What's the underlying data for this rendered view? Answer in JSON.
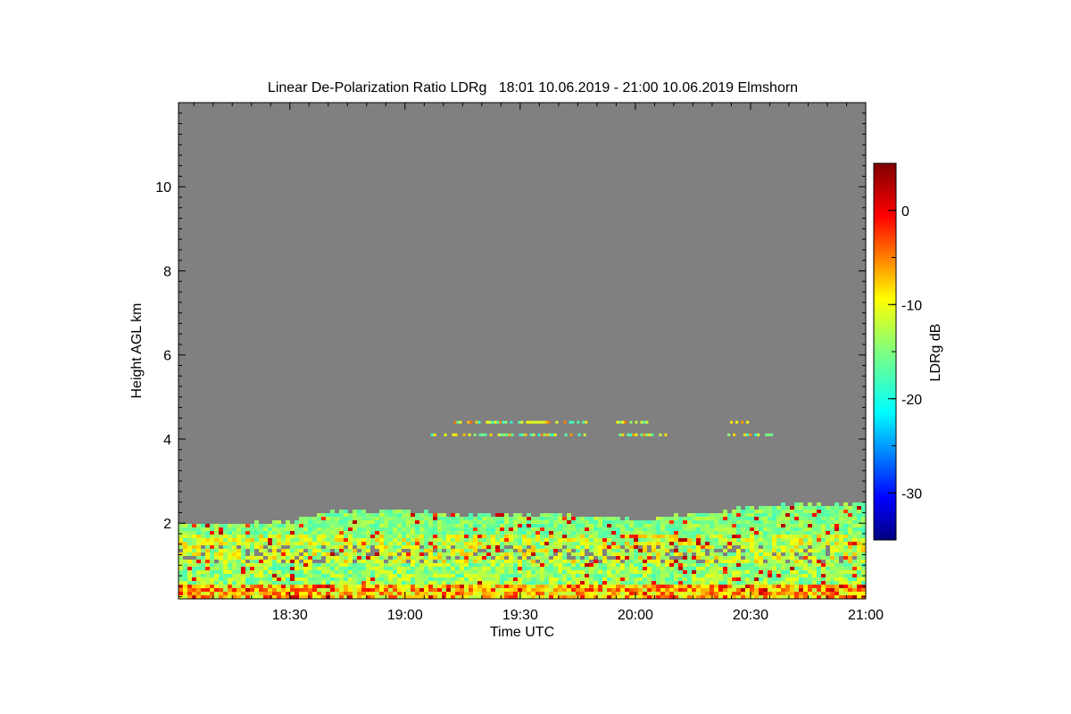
{
  "chart_data": {
    "type": "heatmap",
    "title": "Linear De-Polarization Ratio LDRg   18:01 10.06.2019 - 21:00 10.06.2019 Elmshorn",
    "xlabel": "Time UTC",
    "ylabel": "Height AGL km",
    "colorbar_label": "LDRg dB",
    "x_range": [
      "18:01",
      "21:00"
    ],
    "x_ticks": [
      "18:30",
      "19:00",
      "19:30",
      "20:00",
      "20:30",
      "21:00"
    ],
    "y_range_km": [
      0.2,
      12.0
    ],
    "y_ticks": [
      "2",
      "4",
      "6",
      "8",
      "10"
    ],
    "colorbar_range_db": [
      -35,
      5
    ],
    "colorbar_ticks": [
      "0",
      "-10",
      "-20",
      "-30"
    ],
    "no_data_color": "#808080",
    "colormap": "jet",
    "aerosol_layer_top_km": [
      {
        "time": "18:01",
        "top": 1.95
      },
      {
        "time": "18:15",
        "top": 1.95
      },
      {
        "time": "18:30",
        "top": 2.0
      },
      {
        "time": "18:40",
        "top": 2.25
      },
      {
        "time": "19:00",
        "top": 2.25
      },
      {
        "time": "19:10",
        "top": 2.15
      },
      {
        "time": "19:20",
        "top": 2.2
      },
      {
        "time": "19:40",
        "top": 2.15
      },
      {
        "time": "20:00",
        "top": 2.05
      },
      {
        "time": "20:20",
        "top": 2.2
      },
      {
        "time": "20:30",
        "top": 2.35
      },
      {
        "time": "20:45",
        "top": 2.4
      },
      {
        "time": "21:00",
        "top": 2.45
      }
    ],
    "cloud_features": [
      {
        "start": "19:06",
        "end": "19:47",
        "height_km": 4.1
      },
      {
        "start": "19:12",
        "end": "19:47",
        "height_km": 4.4
      },
      {
        "start": "19:55",
        "end": "20:08",
        "height_km": 4.1
      },
      {
        "start": "19:55",
        "end": "20:03",
        "height_km": 4.4
      },
      {
        "start": "20:24",
        "end": "20:36",
        "height_km": 4.1
      },
      {
        "start": "20:24",
        "end": "20:29",
        "height_km": 4.4
      }
    ]
  }
}
